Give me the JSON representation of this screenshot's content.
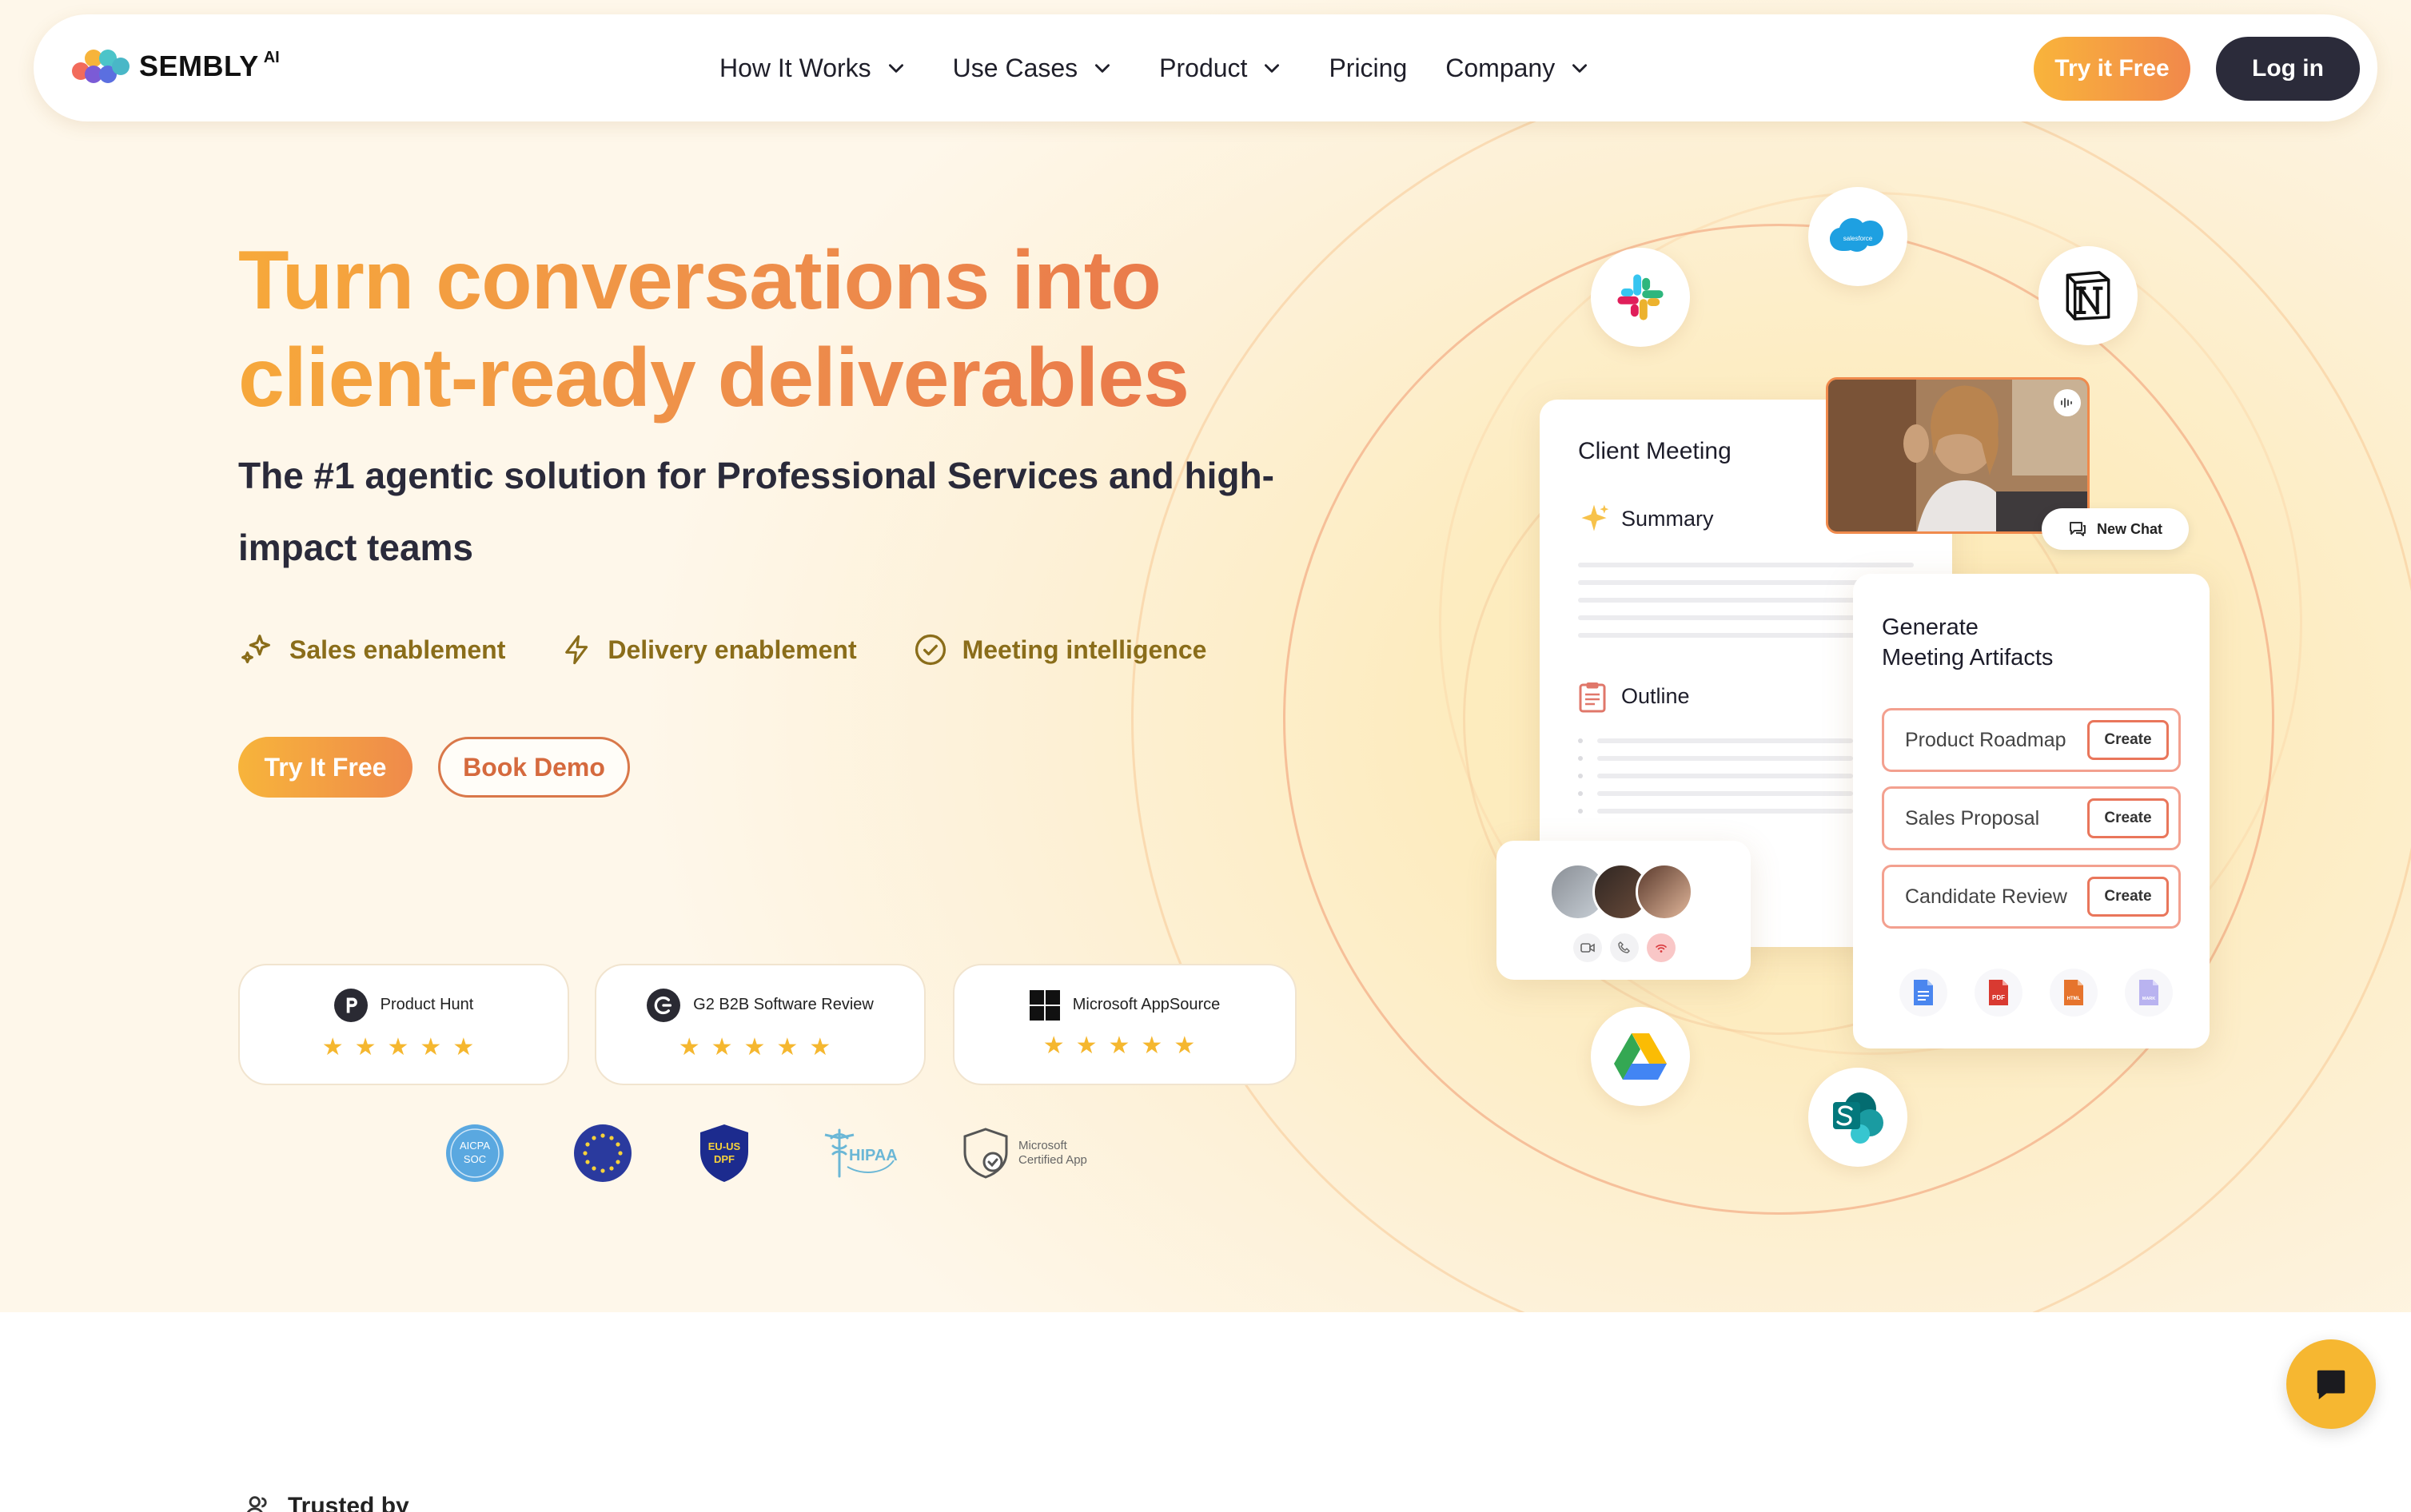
{
  "nav": {
    "logo_text": "SEMBLY",
    "logo_superscript": "AI",
    "items": [
      {
        "label": "How It Works",
        "dropdown": true
      },
      {
        "label": "Use Cases",
        "dropdown": true
      },
      {
        "label": "Product",
        "dropdown": true
      },
      {
        "label": "Pricing",
        "dropdown": false
      },
      {
        "label": "Company",
        "dropdown": true
      }
    ],
    "try_label": "Try it Free",
    "login_label": "Log in"
  },
  "hero": {
    "headline_line1": "Turn conversations into",
    "headline_line2": "client-ready deliverables",
    "subheadline": "The #1 agentic solution for Professional Services and high-impact teams",
    "features": [
      {
        "label": "Sales enablement",
        "icon": "sparkle-icon"
      },
      {
        "label": "Delivery enablement",
        "icon": "lightning-icon"
      },
      {
        "label": "Meeting intelligence",
        "icon": "check-circle-icon"
      }
    ],
    "try_label": "Try It Free",
    "demo_label": "Book Demo"
  },
  "reviews": [
    {
      "name": "Product Hunt",
      "stars": 5,
      "icon": "product-hunt-icon"
    },
    {
      "name": "G2 B2B Software Review",
      "stars": 5,
      "icon": "g2-icon"
    },
    {
      "name": "Microsoft AppSource",
      "stars": 5,
      "icon": "microsoft-icon"
    }
  ],
  "certifications": {
    "aicpa_top": "AICPA",
    "aicpa_bottom": "SOC",
    "eu_us_top": "EU-US",
    "eu_us_bottom": "DPF",
    "hipaa": "HIPAA",
    "ms_line1": "Microsoft",
    "ms_line2": "Certified App"
  },
  "mockup": {
    "meeting_title": "Client Meeting",
    "summary_label": "Summary",
    "outline_label": "Outline",
    "new_chat_label": "New Chat",
    "artifacts_title_line1": "Generate",
    "artifacts_title_line2": "Meeting Artifacts",
    "artifacts": [
      {
        "label": "Product Roadmap",
        "action": "Create"
      },
      {
        "label": "Sales Proposal",
        "action": "Create"
      },
      {
        "label": "Candidate Review",
        "action": "Create"
      }
    ],
    "salesforce_label": "salesforce",
    "pdf_label": "PDF",
    "html_label": "HTML",
    "markdown_label": "MARK"
  },
  "trusted_label": "Trusted by",
  "colors": {
    "accent_orange": "#f08a4c",
    "accent_yellow": "#f7b43b",
    "dark": "#2b2b3a",
    "feature_text": "#8a6d1a"
  }
}
